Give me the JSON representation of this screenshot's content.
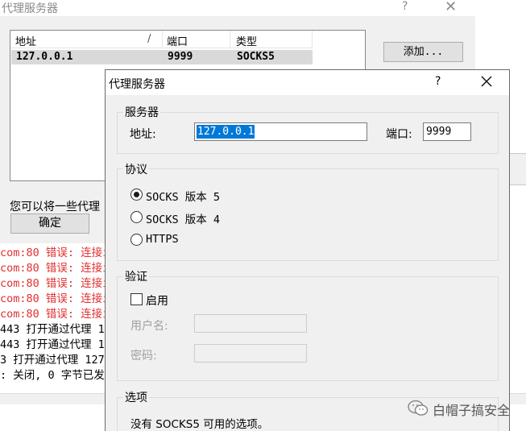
{
  "background_window": {
    "title": "代理服务器",
    "help": "?",
    "columns": [
      "地址",
      "/",
      "端口",
      "类型"
    ],
    "rows": [
      {
        "address": "127.0.0.1",
        "port": "9999",
        "type": "SOCKS5"
      }
    ],
    "add_button": "添加...",
    "hint": "您可以将一些代理",
    "ok_button": "确定"
  },
  "log": {
    "lines": [
      {
        "text": "com:80 错误: 连接i",
        "color": "red"
      },
      {
        "text": "com:80 错误: 连接i",
        "color": "red"
      },
      {
        "text": "com:80 错误: 连接i",
        "color": "red"
      },
      {
        "text": "com:80 错误: 连接i",
        "color": "red"
      },
      {
        "text": "com:80 错误: 连接i",
        "color": "red"
      },
      {
        "text": "443 打开通过代理 1",
        "color": "black"
      },
      {
        "text": "443 打开通过代理 1",
        "color": "black"
      },
      {
        "text": "3 打开通过代理 127",
        "color": "black"
      },
      {
        "text": ": 关闭, 0 字节已发",
        "color": "black"
      }
    ]
  },
  "dialog": {
    "title": "代理服务器",
    "help": "?",
    "server_group": {
      "label": "服务器",
      "address_label": "地址:",
      "address_value": "127.0.0.1",
      "port_label": "端口:",
      "port_value": "9999"
    },
    "protocol_group": {
      "label": "协议",
      "options": [
        {
          "label": "SOCKS 版本 5",
          "selected": true
        },
        {
          "label": "SOCKS 版本 4",
          "selected": false
        },
        {
          "label": "HTTPS",
          "selected": false
        }
      ]
    },
    "auth_group": {
      "label": "验证",
      "enable_label": "启用",
      "enabled": false,
      "username_label": "用户名:",
      "password_label": "密码:"
    },
    "options_group": {
      "label": "选项",
      "text": "没有 SOCKS5 可用的选项。"
    }
  },
  "watermark": {
    "text": "白帽子搞安全"
  }
}
